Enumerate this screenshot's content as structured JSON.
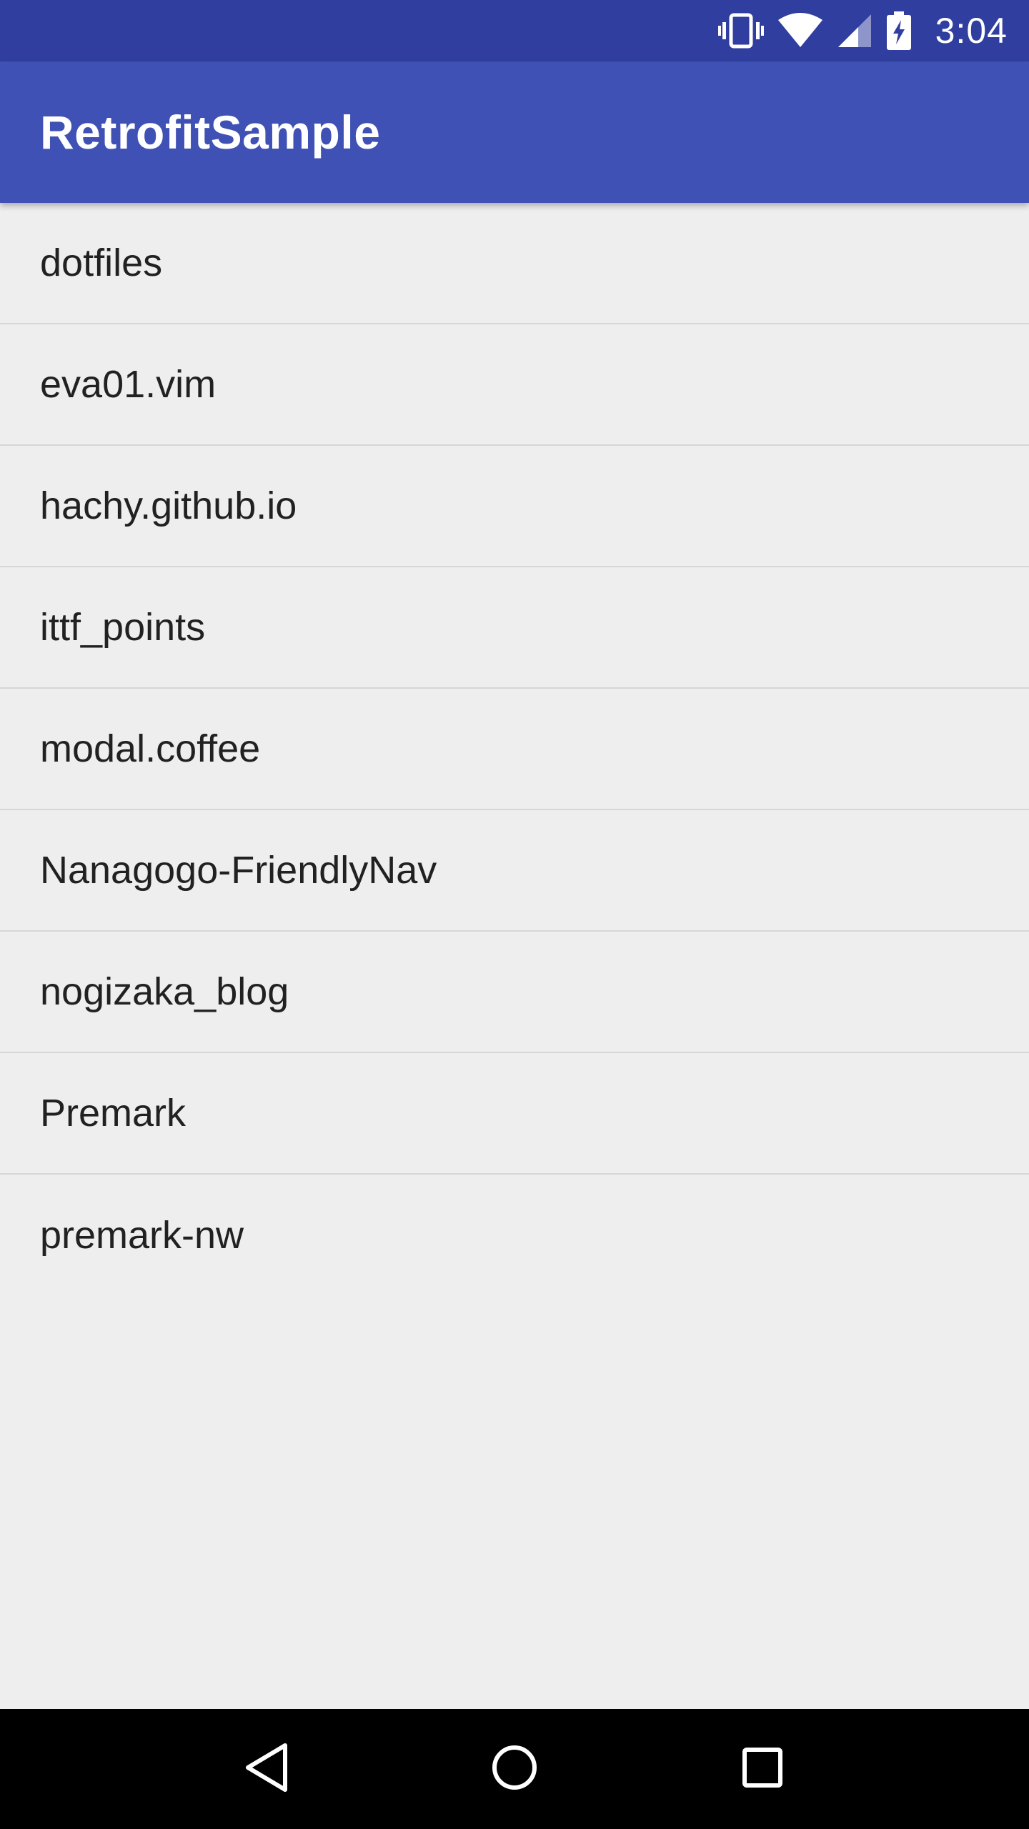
{
  "status_bar": {
    "time": "3:04",
    "icons": [
      "vibrate-icon",
      "wifi-icon",
      "cell-signal-icon",
      "battery-charging-icon"
    ],
    "background_color": "#303f9f"
  },
  "app_bar": {
    "title": "RetrofitSample",
    "background_color": "#3f51b5"
  },
  "repo_list": {
    "items": [
      {
        "label": "dotfiles"
      },
      {
        "label": "eva01.vim"
      },
      {
        "label": "hachy.github.io"
      },
      {
        "label": "ittf_points"
      },
      {
        "label": "modal.coffee"
      },
      {
        "label": "Nanagogo-FriendlyNav"
      },
      {
        "label": "nogizaka_blog"
      },
      {
        "label": "Premark"
      },
      {
        "label": "premark-nw"
      }
    ]
  },
  "nav_bar": {
    "buttons": [
      "back-icon",
      "home-icon",
      "recents-icon"
    ]
  }
}
